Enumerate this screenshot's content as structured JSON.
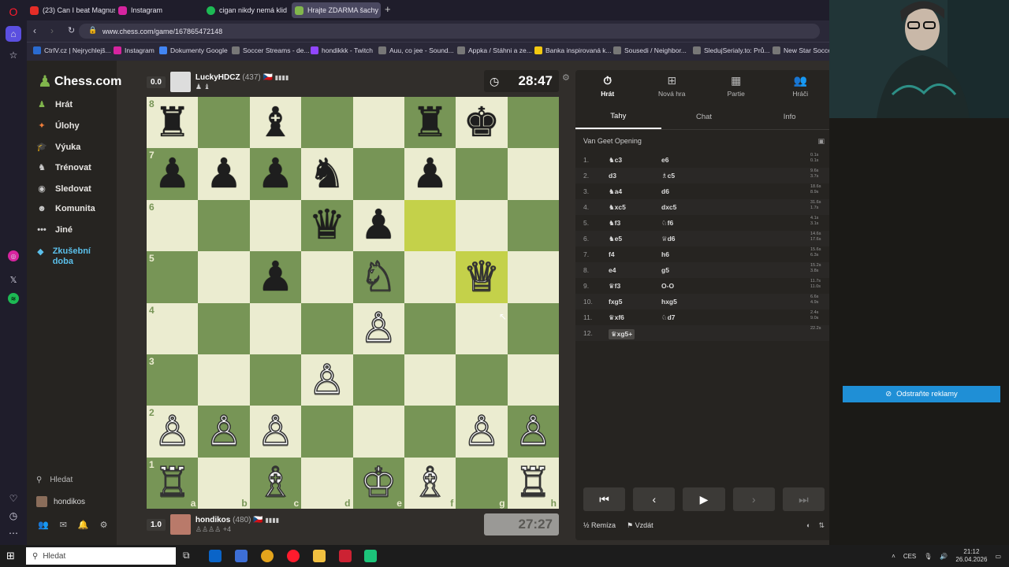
{
  "browser": {
    "tabs": [
      {
        "title": "(23) Can I beat Magnus C",
        "color": "#e52d27"
      },
      {
        "title": "Instagram",
        "color": "#d6249f"
      },
      {
        "title": "cigan nikdy nemá klid",
        "color": "#1db954"
      },
      {
        "title": "Hrajte ZDARMA šachy",
        "color": "#81b64c"
      }
    ],
    "url": "www.chess.com/game/167865472148",
    "bookmarks": [
      {
        "label": "CtrlV.cz | Nejrychlejš...",
        "color": "#2a6bd1"
      },
      {
        "label": "Instagram",
        "color": "#d6249f"
      },
      {
        "label": "Dokumenty Google",
        "color": "#4285f4"
      },
      {
        "label": "Soccer Streams - de...",
        "color": "#777777"
      },
      {
        "label": "hondikkk - Twitch",
        "color": "#9146ff"
      },
      {
        "label": "Auu, co jee - Sound...",
        "color": "#777777"
      },
      {
        "label": "Appka / Stáhni a ze...",
        "color": "#777777"
      },
      {
        "label": "Banka inspirovaná k...",
        "color": "#f2c811"
      },
      {
        "label": "Sousedi / Neighbor...",
        "color": "#777777"
      },
      {
        "label": "SledujSerialy.to: Prů...",
        "color": "#777777"
      },
      {
        "label": "New Star Soccer",
        "color": "#777777"
      }
    ]
  },
  "sidebar": {
    "logo": "Chess.com",
    "items": [
      {
        "label": "Hrát",
        "icon": "♟",
        "color": "#81b64c"
      },
      {
        "label": "Úlohy",
        "icon": "✦",
        "color": "#f07d3a"
      },
      {
        "label": "Výuka",
        "icon": "🎓",
        "color": "#3fa9d8"
      },
      {
        "label": "Trénovat",
        "icon": "♞",
        "color": "#ccc"
      },
      {
        "label": "Sledovat",
        "icon": "◉",
        "color": "#ccc"
      },
      {
        "label": "Komunita",
        "icon": "☻",
        "color": "#ccc"
      },
      {
        "label": "Jiné",
        "icon": "•••",
        "color": "#ccc"
      },
      {
        "label": "Zkušební doba",
        "icon": "◆",
        "color": "#5bc0eb"
      }
    ],
    "search": "Hledat",
    "user": "hondikos"
  },
  "top_player": {
    "score": "0.0",
    "name": "LuckyHDCZ",
    "rating": "(437)",
    "flag": "🇨🇿",
    "clock": "28:47"
  },
  "bottom_player": {
    "score": "1.0",
    "name": "hondikos",
    "rating": "(480)",
    "flag": "🇨🇿",
    "extra": "+4",
    "clock": "27:27"
  },
  "board": {
    "rows": [
      [
        "♜",
        "",
        "♝",
        "",
        "",
        "♜",
        "♚",
        ""
      ],
      [
        "♟",
        "♟",
        "♟",
        "♞",
        "",
        "♟",
        "",
        ""
      ],
      [
        "",
        "",
        "",
        "♛",
        "♟",
        "",
        "",
        ""
      ],
      [
        "",
        "",
        "♟",
        "",
        "♘",
        "",
        "♕",
        ""
      ],
      [
        "",
        "",
        "",
        "",
        "♙",
        "",
        "",
        ""
      ],
      [
        "",
        "",
        "",
        "♙",
        "",
        "",
        "",
        ""
      ],
      [
        "♙",
        "♙",
        "♙",
        "",
        "",
        "",
        "♙",
        "♙"
      ],
      [
        "♖",
        "",
        "♗",
        "",
        "♔",
        "♗",
        "",
        "♖"
      ]
    ],
    "white_pieces": [
      "♔",
      "♕",
      "♖",
      "♗",
      "♘",
      "♙"
    ],
    "ranks": [
      "8",
      "7",
      "6",
      "5",
      "4",
      "3",
      "2",
      "1"
    ],
    "files": [
      "a",
      "b",
      "c",
      "d",
      "e",
      "f",
      "g",
      "h"
    ],
    "highlight": [
      [
        2,
        5
      ],
      [
        3,
        6
      ]
    ]
  },
  "panel": {
    "tabs": [
      {
        "label": "Hrát",
        "icon": "⏱"
      },
      {
        "label": "Nová hra",
        "icon": "⊞"
      },
      {
        "label": "Partie",
        "icon": "▦"
      },
      {
        "label": "Hráči",
        "icon": "👥"
      }
    ],
    "subtabs": [
      "Tahy",
      "Chat",
      "Info"
    ],
    "opening": "Van Geet Opening",
    "moves": [
      {
        "n": "1.",
        "w": "♞c3",
        "b": "e6",
        "tw": "0.1s",
        "tb": "0.1s"
      },
      {
        "n": "2.",
        "w": "d3",
        "b": "♗c5",
        "tw": "9.6s",
        "tb": "3.7s"
      },
      {
        "n": "3.",
        "w": "♞a4",
        "b": "d6",
        "tw": "18.6s",
        "tb": "8.9s"
      },
      {
        "n": "4.",
        "w": "♞xc5",
        "b": "dxc5",
        "tw": "31.6s",
        "tb": "1.7s"
      },
      {
        "n": "5.",
        "w": "♞f3",
        "b": "♘f6",
        "tw": "4.1s",
        "tb": "3.1s"
      },
      {
        "n": "6.",
        "w": "♞e5",
        "b": "♕d6",
        "tw": "14.6s",
        "tb": "17.6s"
      },
      {
        "n": "7.",
        "w": "f4",
        "b": "h6",
        "tw": "15.6s",
        "tb": "6.3s"
      },
      {
        "n": "8.",
        "w": "e4",
        "b": "g5",
        "tw": "15.2s",
        "tb": "3.8s"
      },
      {
        "n": "9.",
        "w": "♛f3",
        "b": "O-O",
        "tw": "11.7s",
        "tb": "11.0s"
      },
      {
        "n": "10.",
        "w": "fxg5",
        "b": "hxg5",
        "tw": "6.6s",
        "tb": "4.9s"
      },
      {
        "n": "11.",
        "w": "♛xf6",
        "b": "♘d7",
        "tw": "2.4s",
        "tb": "9.0s"
      },
      {
        "n": "12.",
        "w": "♛xg5+",
        "b": "",
        "tw": "22.2s",
        "tb": ""
      }
    ],
    "draw": "Remíza",
    "resign": "Vzdát"
  },
  "ad_button": "Odstraňte reklamy",
  "taskbar": {
    "search": "Hledat",
    "lang": "CES",
    "time": "21:12",
    "date": "26.04.2026"
  }
}
